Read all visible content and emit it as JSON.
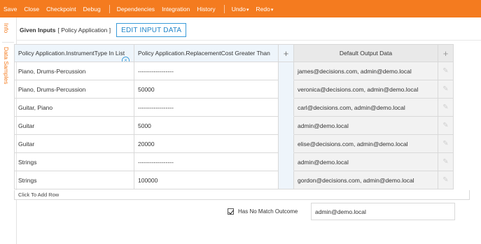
{
  "toolbar": {
    "items": [
      "Save",
      "Close",
      "Checkpoint",
      "Debug",
      "Dependencies",
      "Integration",
      "History",
      "Undo",
      "Redo"
    ]
  },
  "sidebar": {
    "tabs": [
      "Info",
      "Data Samples"
    ]
  },
  "given_inputs": {
    "label": "Given Inputs",
    "context": "[ Policy Application ]",
    "edit_button": "EDIT INPUT DATA"
  },
  "table": {
    "headers": {
      "col1": "Policy Application.InstrumentType In List",
      "col2": "Policy Application.ReplacementCost Greater Than",
      "add_column": "+",
      "output": "Default Output Data",
      "add_output": "+"
    },
    "rows": [
      {
        "instrument": "Piano, Drums-Percussion",
        "cost": "------------------",
        "output": "james@decisions.com, admin@demo.local"
      },
      {
        "instrument": "Piano, Drums-Percussion",
        "cost": "50000",
        "output": "veronica@decisions.com, admin@demo.local"
      },
      {
        "instrument": "Guitar, Piano",
        "cost": "------------------",
        "output": "carl@decisions.com, admin@demo.local"
      },
      {
        "instrument": "Guitar",
        "cost": "5000",
        "output": "admin@demo.local"
      },
      {
        "instrument": "Guitar",
        "cost": "20000",
        "output": "elise@decisions.com, admin@demo.local"
      },
      {
        "instrument": "Strings",
        "cost": "------------------",
        "output": "admin@demo.local"
      },
      {
        "instrument": "Strings",
        "cost": "100000",
        "output": "gordon@decisions.com, admin@demo.local"
      }
    ],
    "add_row_label": "Click To Add Row"
  },
  "no_match": {
    "label": "Has No Match Outcome",
    "checked": true,
    "value": "admin@demo.local"
  },
  "colors": {
    "accent": "#f47b1f",
    "link_blue": "#1f84c8",
    "header_blue": "#eef5fb"
  }
}
